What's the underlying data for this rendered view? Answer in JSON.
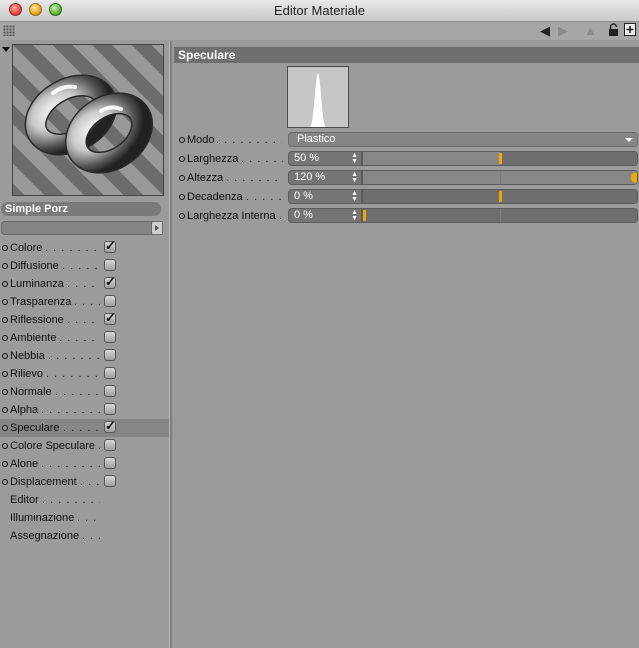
{
  "window": {
    "title": "Editor Materiale"
  },
  "toolbar": {
    "icons": [
      "back-arrow-icon",
      "forward-arrow-icon",
      "up-arrow-icon",
      "lock-icon",
      "new-window-icon"
    ]
  },
  "colors": {
    "accent": "#f0a800",
    "section_header": "#6f6f6f",
    "panel_bg": "#9b9b9b"
  },
  "material": {
    "name": "Simple Porz"
  },
  "channels": [
    {
      "label": "Colore",
      "has_checkbox": true,
      "checked": true,
      "active": false
    },
    {
      "label": "Diffusione",
      "has_checkbox": true,
      "checked": false,
      "active": false
    },
    {
      "label": "Luminanza",
      "has_checkbox": true,
      "checked": true,
      "active": false
    },
    {
      "label": "Trasparenza",
      "has_checkbox": true,
      "checked": false,
      "active": false
    },
    {
      "label": "Riflessione",
      "has_checkbox": true,
      "checked": true,
      "active": false
    },
    {
      "label": "Ambiente",
      "has_checkbox": true,
      "checked": false,
      "active": false
    },
    {
      "label": "Nebbia",
      "has_checkbox": true,
      "checked": false,
      "active": false
    },
    {
      "label": "Rilievo",
      "has_checkbox": true,
      "checked": false,
      "active": false
    },
    {
      "label": "Normale",
      "has_checkbox": true,
      "checked": false,
      "active": false
    },
    {
      "label": "Alpha",
      "has_checkbox": true,
      "checked": false,
      "active": false
    },
    {
      "label": "Speculare",
      "has_checkbox": true,
      "checked": true,
      "active": true
    },
    {
      "label": "Colore Speculare",
      "has_checkbox": true,
      "checked": false,
      "active": false
    },
    {
      "label": "Alone",
      "has_checkbox": true,
      "checked": false,
      "active": false
    },
    {
      "label": "Displacement",
      "has_checkbox": true,
      "checked": false,
      "active": false
    },
    {
      "label": "Editor",
      "has_checkbox": false,
      "checked": false,
      "active": false
    },
    {
      "label": "Illuminazione",
      "has_checkbox": false,
      "checked": false,
      "active": false
    },
    {
      "label": "Assegnazione",
      "has_checkbox": false,
      "checked": false,
      "active": false
    }
  ],
  "section": {
    "title": "Speculare",
    "modo": {
      "label": "Modo",
      "value": "Plastico"
    },
    "params": [
      {
        "label": "Larghezza",
        "value": "50 %",
        "fraction": 0.5
      },
      {
        "label": "Altezza",
        "value": "120 %",
        "fraction": 1.2
      },
      {
        "label": "Decadenza",
        "value": "0 %",
        "fraction": 0.0,
        "marker": 0.5
      },
      {
        "label": "Larghezza Interna",
        "value": "0 %",
        "fraction": 0.0
      }
    ]
  }
}
